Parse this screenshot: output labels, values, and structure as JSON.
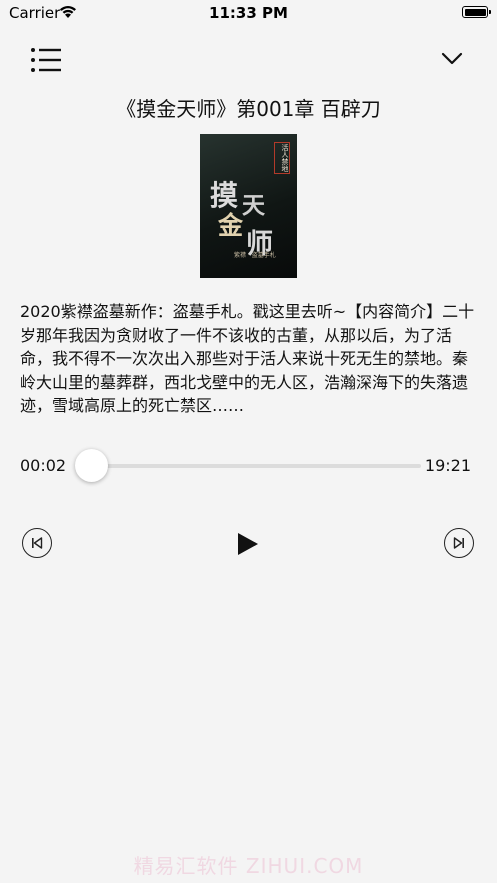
{
  "status_bar": {
    "carrier": "Carrier",
    "time": "11:33 PM",
    "wifi_icon": "wifi-icon",
    "battery_icon": "battery-icon"
  },
  "nav": {
    "list_icon": "list-icon",
    "collapse_icon": "chevron-down-icon"
  },
  "episode": {
    "title": "《摸金天师》第001章 百辟刀",
    "description": "2020紫襟盗墓新作：盗墓手札。戳这里去听~【内容简介】二十岁那年我因为贪财收了一件不该收的古董，从那以后，为了活命，我不得不一次次出入那些对于活人来说十死无生的禁地。秦岭大山里的墓葬群，西北戈壁中的无人区，浩瀚深海下的失落遗迹，雪域高原上的死亡禁区……"
  },
  "cover": {
    "tag": "活人禁地",
    "t1": "摸",
    "t2": "天",
    "t3": "金",
    "t4": "师",
    "subtitle": "紫襟 · 盗墓手札"
  },
  "player": {
    "current_time": "00:02",
    "total_time": "19:21",
    "progress": 0.002,
    "prev_icon": "skip-back-icon",
    "play_icon": "play-icon",
    "next_icon": "skip-forward-icon"
  },
  "watermark": "精易汇软件 ZIHUI.COM",
  "colors": {
    "background": "#f4f4f4",
    "text": "#111111",
    "track": "#dcdcdc",
    "thumb": "#ffffff"
  }
}
